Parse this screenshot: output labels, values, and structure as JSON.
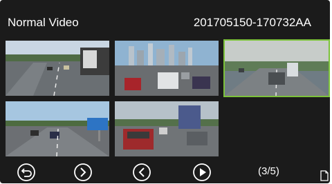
{
  "header": {
    "mode_title": "Normal Video",
    "file_name": "201705150-170732AA"
  },
  "gallery": {
    "thumbnails": [
      {
        "scene": "highway with truck and trees",
        "selected": false
      },
      {
        "scene": "city skyline traffic",
        "selected": false
      },
      {
        "scene": "foggy road with truck",
        "selected": true
      },
      {
        "scene": "highway with blue road sign",
        "selected": false
      },
      {
        "scene": "traffic behind red car",
        "selected": false
      }
    ]
  },
  "toolbar": {
    "buttons": [
      {
        "name": "back-button",
        "icon": "back-icon"
      },
      {
        "name": "next-page-button",
        "icon": "chevron-right-icon"
      },
      {
        "name": "previous-button",
        "icon": "chevron-left-icon"
      },
      {
        "name": "play-button",
        "icon": "play-icon"
      }
    ],
    "page_indicator": "(3/5)",
    "page_icon": "document-icon"
  },
  "colors": {
    "background": "#1b1b1b",
    "selection_border": "#7cc23a",
    "text": "#ffffff"
  }
}
